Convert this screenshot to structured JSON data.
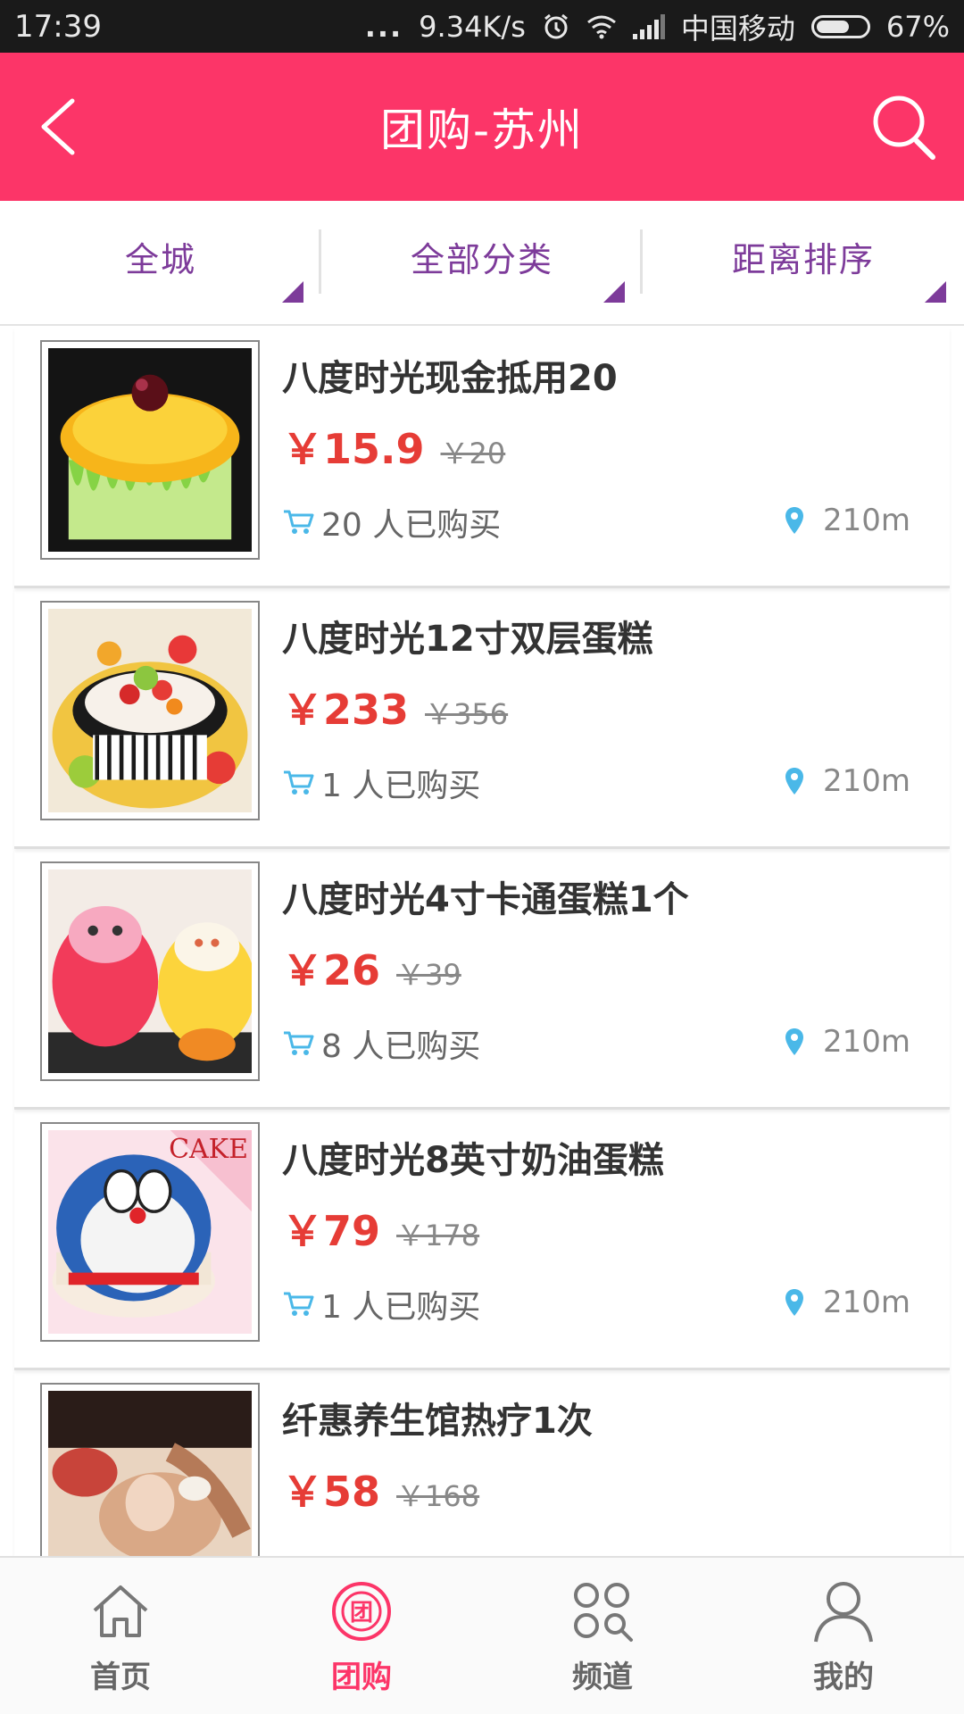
{
  "status_bar": {
    "time": "17:39",
    "dots": "...",
    "speed": "9.34K/s",
    "carrier": "中国移动",
    "battery_text": "67%",
    "battery_level": 0.67
  },
  "header": {
    "title": "团购-苏州",
    "back_icon": "chevron-left-icon",
    "search_icon": "search-icon",
    "bg_color": "#fc3568"
  },
  "filters": [
    {
      "label": "全城"
    },
    {
      "label": "全部分类"
    },
    {
      "label": "距离排序"
    }
  ],
  "deals": [
    {
      "title": "八度时光现金抵用20",
      "price": "￥15.9",
      "original_price": "￥20",
      "sold": "20 人已购买",
      "distance": "210m"
    },
    {
      "title": "八度时光12寸双层蛋糕",
      "price": "￥233",
      "original_price": "￥356",
      "sold": "1 人已购买",
      "distance": "210m"
    },
    {
      "title": "八度时光4寸卡通蛋糕1个",
      "price": "￥26",
      "original_price": "￥39",
      "sold": "8 人已购买",
      "distance": "210m"
    },
    {
      "title": "八度时光8英寸奶油蛋糕",
      "price": "￥79",
      "original_price": "￥178",
      "sold": "1 人已购买",
      "distance": "210m",
      "image_text": "CAKE"
    },
    {
      "title": "纤惠养生馆热疗1次",
      "price": "￥58",
      "original_price": "￥168",
      "sold": "",
      "distance": ""
    }
  ],
  "bottom_nav": [
    {
      "label": "首页",
      "icon": "home-icon"
    },
    {
      "label": "团购",
      "icon": "group-buy-icon",
      "active": true
    },
    {
      "label": "频道",
      "icon": "channel-grid-icon"
    },
    {
      "label": "我的",
      "icon": "user-icon"
    }
  ],
  "colors": {
    "accent": "#fc3568",
    "filter_text": "#7d3b9a",
    "price": "#e63c36",
    "icon_blue": "#4ab8e8"
  }
}
